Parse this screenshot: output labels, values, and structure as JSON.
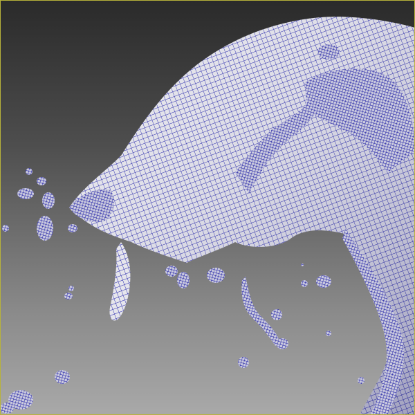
{
  "viewport": {
    "view_mode": "wireframe-on-shaded",
    "wire_color": "#1010a0",
    "surface_color": "#e8e8ee",
    "active_border_color": "#b8b33a"
  }
}
